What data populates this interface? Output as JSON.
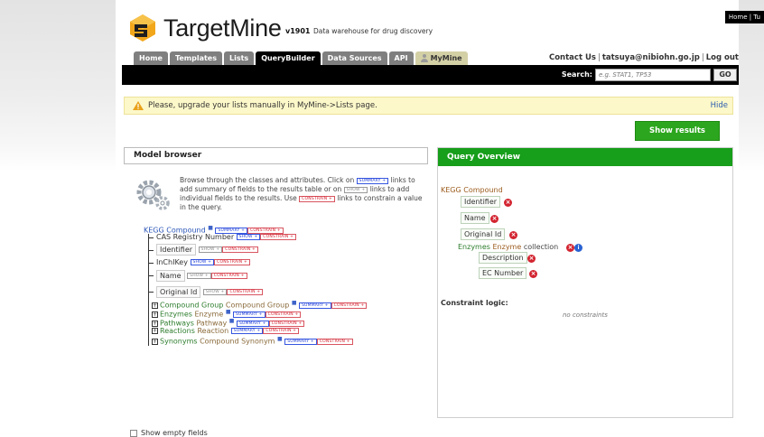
{
  "corner_links": "Home | Tu",
  "brand": {
    "name": "TargetMine",
    "version": "v1901",
    "tagline": "Data warehouse for drug discovery"
  },
  "tabs": [
    {
      "label": "Home"
    },
    {
      "label": "Templates"
    },
    {
      "label": "Lists"
    },
    {
      "label": "QueryBuilder",
      "active": true
    },
    {
      "label": "Data Sources"
    },
    {
      "label": "API"
    },
    {
      "label": "MyMine"
    }
  ],
  "userbar": {
    "contact": "Contact Us",
    "user": "tatsuya@nibiohn.go.jp",
    "logout": "Log out"
  },
  "search": {
    "label": "Search:",
    "placeholder": "e.g. STAT1, TP53",
    "go": "GO"
  },
  "warning": {
    "text": "Please, upgrade your lists manually in MyMine->Lists page.",
    "hide": "Hide"
  },
  "show_results": "Show results",
  "model_browser": {
    "title": "Model browser",
    "help": {
      "p1": "Browse through the classes and attributes. Click on",
      "p2": "links to add summary of fields to the results table or on",
      "p3": "links to add individual fields to the results. Use",
      "p4": "links to constrain a value in the query."
    },
    "badges": {
      "summary": "SUMMARY +",
      "show": "SHOW +",
      "constrain": "CONSTRAIN +"
    },
    "root": "KEGG Compound",
    "attributes": [
      {
        "label": "CAS Registry Number",
        "boxed": false
      },
      {
        "label": "Identifier",
        "boxed": true
      },
      {
        "label": "InChIKey",
        "boxed": false
      },
      {
        "label": "Name",
        "boxed": true
      },
      {
        "label": "Original Id",
        "boxed": true
      }
    ],
    "collections": [
      {
        "name": "Compound Group",
        "type": "Compound Group"
      },
      {
        "name": "Enzymes",
        "type": "Enzyme"
      },
      {
        "name": "Pathways",
        "type": "Pathway"
      },
      {
        "name": "Reactions",
        "type": "Reaction"
      },
      {
        "name": "Synonyms",
        "type": "Compound Synonym"
      }
    ],
    "show_empty": "Show empty fields"
  },
  "query_overview": {
    "title": "Query Overview",
    "root": "KEGG Compound",
    "fields": [
      "Identifier",
      "Name",
      "Original Id"
    ],
    "collection": {
      "name": "Enzymes",
      "type": "Enzyme",
      "kind": "collection"
    },
    "collection_fields": [
      "Description",
      "EC Number"
    ],
    "constraint_label": "Constraint logic:",
    "no_constraints": "no constraints"
  }
}
